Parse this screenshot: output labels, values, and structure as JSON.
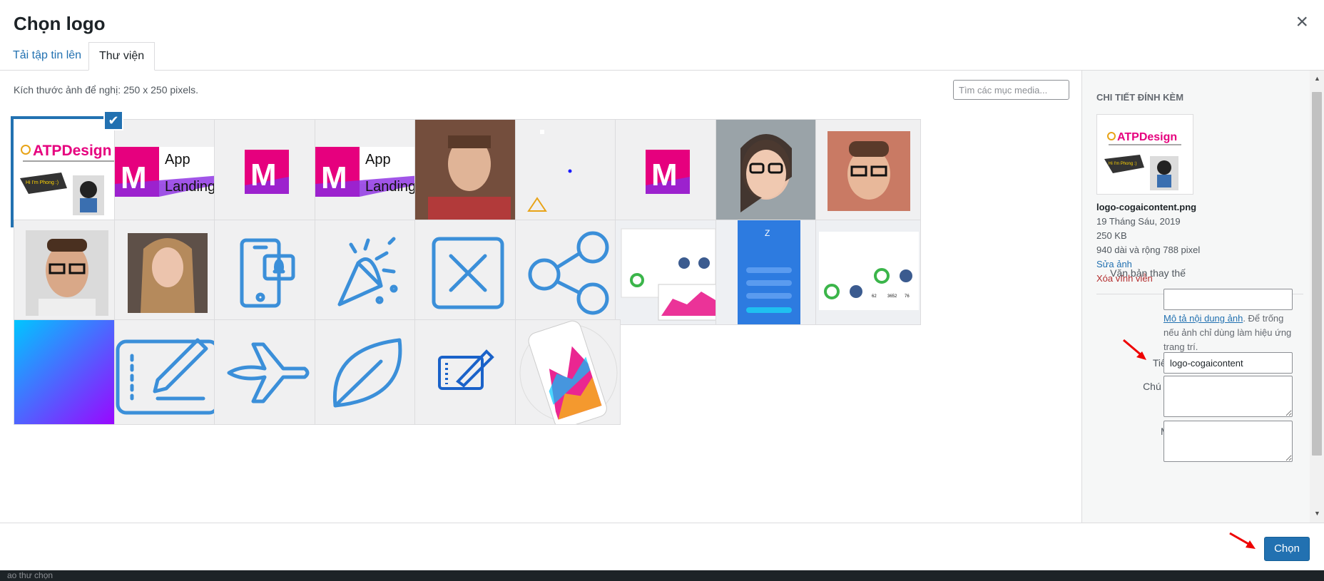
{
  "header": {
    "title": "Chọn logo",
    "close_icon": "close-icon"
  },
  "tabs": [
    {
      "label": "Tải tập tin lên",
      "active": false
    },
    {
      "label": "Thư viện",
      "active": true
    }
  ],
  "toolbar": {
    "size_note": "Kích thước ảnh để nghị: 250 x 250 pixels.",
    "search_placeholder": "Tìm các mục media..."
  },
  "library": {
    "items": [
      {
        "name": "logo-atpdesign",
        "selected": true,
        "logo_text": "ATPDesign",
        "logo_caption": "Hi I'm Phong :)"
      },
      {
        "name": "app-landing-logo",
        "selected": false,
        "line1": "App",
        "line2": "Landing",
        "letter": "M"
      },
      {
        "name": "m-logo",
        "selected": false,
        "letter": "M"
      },
      {
        "name": "app-landing-logo-2",
        "selected": false,
        "line1": "App",
        "line2": "Landing",
        "letter": "M"
      },
      {
        "name": "man-portrait",
        "selected": false
      },
      {
        "name": "shapes-graphic",
        "selected": false
      },
      {
        "name": "m-logo-2",
        "selected": false,
        "letter": "M"
      },
      {
        "name": "woman-glasses-portrait",
        "selected": false
      },
      {
        "name": "man-glasses-portrait",
        "selected": false
      },
      {
        "name": "man-glasses-portrait-2",
        "selected": false
      },
      {
        "name": "woman-portrait",
        "selected": false
      },
      {
        "name": "phone-notification-icon",
        "selected": false
      },
      {
        "name": "party-popper-icon",
        "selected": false
      },
      {
        "name": "close-box-icon",
        "selected": false
      },
      {
        "name": "share-icon",
        "selected": false
      },
      {
        "name": "dashboard-screenshot",
        "selected": false
      },
      {
        "name": "mobile-app-screenshot",
        "selected": false,
        "letter": "Z"
      },
      {
        "name": "dashboard-screenshot-2",
        "selected": false,
        "stats": [
          "62",
          "3652",
          "76"
        ]
      },
      {
        "name": "gradient-background",
        "selected": false
      },
      {
        "name": "drawing-tablet-icon",
        "selected": false
      },
      {
        "name": "airplane-icon",
        "selected": false
      },
      {
        "name": "leaf-icon",
        "selected": false
      },
      {
        "name": "drawing-tablet-icon-small",
        "selected": false
      },
      {
        "name": "phone-chart-mockup",
        "selected": false
      }
    ]
  },
  "details": {
    "heading": "CHI TIẾT ĐÍNH KÈM",
    "thumb_logo_text": "ATPDesign",
    "thumb_caption": "Hi I'm Phong :)",
    "filename": "logo-cogaicontent.png",
    "date": "19 Tháng Sáu, 2019",
    "filesize": "250 KB",
    "dimensions": "940 dài và rộng 788 pixel",
    "edit_link": "Sửa ảnh",
    "delete_link": "Xóa vĩnh viễn",
    "alt_label": "Văn bản thay thế",
    "alt_value": "",
    "alt_help_link": "Mô tả nội dung ảnh",
    "alt_help_text": ". Để trống nếu ảnh chỉ dùng làm hiệu ứng trang trí.",
    "title_label": "Tiêu đề",
    "title_value": "logo-cogaicontent",
    "caption_label": "Chú thích",
    "caption_value": "",
    "description_label": "Mô tả",
    "description_value": ""
  },
  "footer": {
    "choose_label": "Chọn"
  },
  "background": {
    "strip_text": "ao thư chọn"
  },
  "colors": {
    "accent": "#2271b1",
    "danger": "#b32d2e",
    "magenta": "#e6007e",
    "purple": "#8a2be2",
    "icon_blue": "#3b8fd9"
  }
}
